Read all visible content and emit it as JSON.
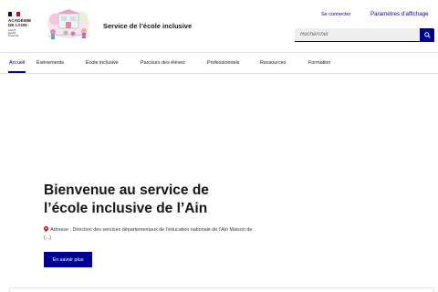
{
  "header": {
    "logo": {
      "institution_lines": [
        "ACADÉMIE",
        "DE LYON"
      ],
      "motto_lines": [
        "Liberté",
        "Égalité",
        "Fraternité"
      ],
      "flag_colors": [
        "#000091",
        "#ffffff",
        "#e1000f"
      ]
    },
    "site_title": "Service de l’école inclusive",
    "login_label": "Se connecter",
    "display_settings_label": "Paramètres d’affichage",
    "search": {
      "placeholder": "Rechercher",
      "button_icon": "search-icon"
    }
  },
  "nav": {
    "items": [
      {
        "label": "Accueil",
        "active": true
      },
      {
        "label": "Événements"
      },
      {
        "label": "École inclusive"
      },
      {
        "label": "Parcours des élèves"
      },
      {
        "label": "Professionnels"
      },
      {
        "label": "Ressources"
      },
      {
        "label": "Formation"
      }
    ]
  },
  "hero": {
    "title_line1": "Bienvenue au service de",
    "title_line2": "l’école inclusive de l’Ain",
    "address_icon": "pin-icon",
    "address_text": "Adresse : Direction des services départementaux de l’éducation nationale de l’Ain Maison de (...)",
    "cta_label": "En savoir plus"
  },
  "colors": {
    "brand_blue": "#000091",
    "text": "#161616",
    "marianne_red": "#e1000f"
  }
}
